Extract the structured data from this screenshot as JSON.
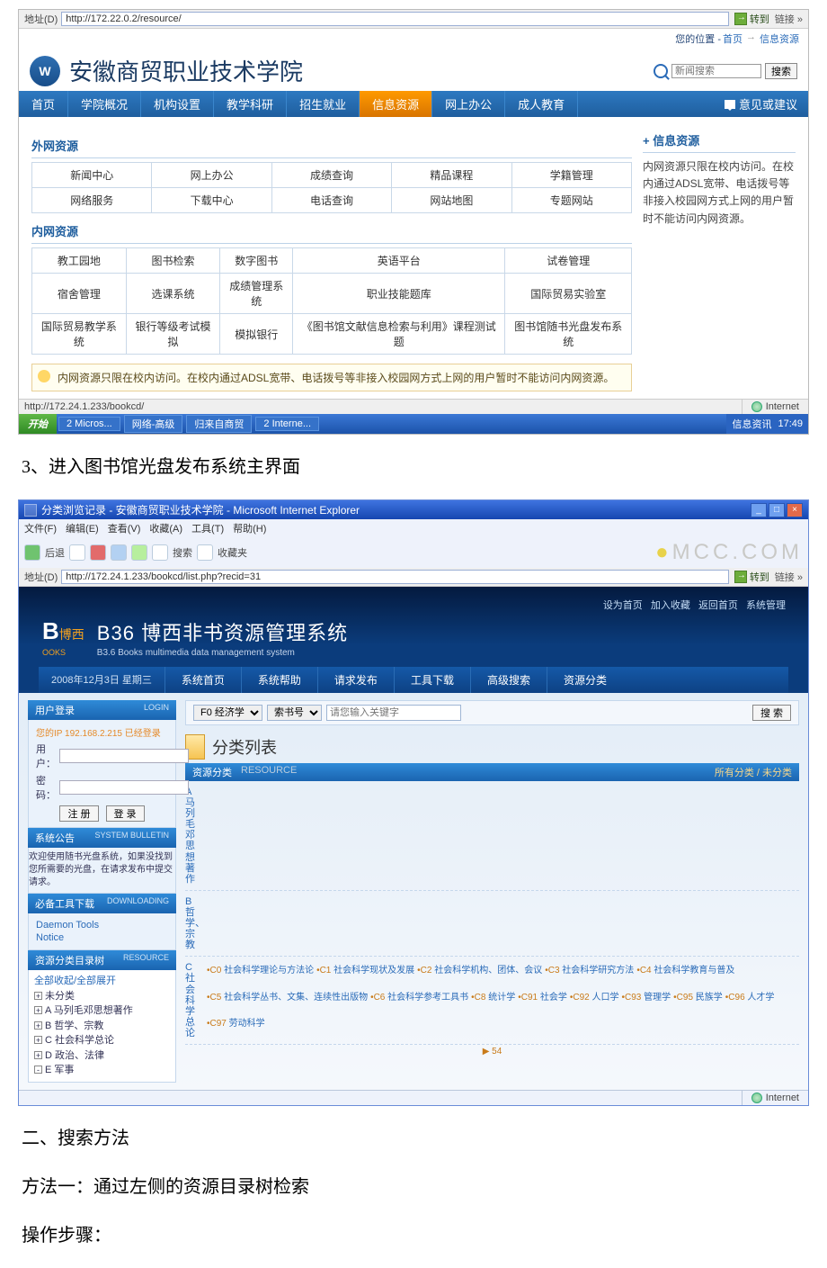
{
  "shot1": {
    "address_label": "地址(D)",
    "url": "http://172.22.0.2/resource/",
    "go_label": "转到",
    "go_tail": "链接 »",
    "breadcrumb_prefix": "您的位置 -",
    "breadcrumb_home": "首页",
    "breadcrumb_sep": "→",
    "breadcrumb_current": "信息资源",
    "school_name": "安徽商贸职业技术学院",
    "search_placeholder": "新闻搜索",
    "search_btn": "搜索",
    "nav": [
      "首页",
      "学院概况",
      "机构设置",
      "教学科研",
      "招生就业",
      "信息资源",
      "网上办公",
      "成人教育"
    ],
    "nav_active_index": 5,
    "feedback": "意见或建议",
    "section_outer": "外网资源",
    "grid_outer": [
      [
        "新闻中心",
        "网上办公",
        "成绩查询",
        "精品课程",
        "学籍管理"
      ],
      [
        "网络服务",
        "下载中心",
        "电话查询",
        "网站地图",
        "专题网站"
      ]
    ],
    "section_inner": "内网资源",
    "grid_inner": [
      [
        "教工园地",
        "图书检索",
        "数字图书",
        "英语平台",
        "试卷管理"
      ],
      [
        "宿舍管理",
        "选课系统",
        "成绩管理系统",
        "职业技能题库",
        "国际贸易实验室"
      ],
      [
        "国际贸易教学系统",
        "银行等级考试模拟",
        "模拟银行",
        "《图书馆文献信息检索与利用》课程测试题",
        "图书馆随书光盘发布系统"
      ]
    ],
    "side_title_prefix": "+",
    "side_title": "信息资源",
    "side_body": "内网资源只限在校内访问。在校内通过ADSL宽带、电话拨号等非接入校园网方式上网的用户暂时不能访问内网资源。",
    "notice": "内网资源只限在校内访问。在校内通过ADSL宽带、电话拨号等非接入校园网方式上网的用户暂时不能访问内网资源。",
    "status_url": "http://172.24.1.233/bookcd/",
    "status_zone": "Internet",
    "taskbar": {
      "start": "开始",
      "buttons": [
        "2 Micros...",
        "网络-高级",
        "归来自商贸",
        "2 Interne..."
      ],
      "tray_msg": "信息资讯",
      "clock": "17:49"
    }
  },
  "doc": {
    "step3": "3、进入图书馆光盘发布系统主界面",
    "h2": "二、搜索方法",
    "m1": "方法一：通过左侧的资源目录树检索",
    "steps_label": "操作步骤："
  },
  "shot2": {
    "window_title": "分类浏览记录 - 安徽商贸职业技术学院 - Microsoft Internet Explorer",
    "menus": [
      "文件(F)",
      "编辑(E)",
      "查看(V)",
      "收藏(A)",
      "工具(T)",
      "帮助(H)"
    ],
    "toolbar": {
      "back": "后退",
      "search": "搜索",
      "fav": "收藏夹"
    },
    "watermark": "MCC.COM",
    "address_label": "地址(D)",
    "url": "http://172.24.1.233/bookcd/list.php?recid=31",
    "go_label": "转到",
    "go_tail": "链接 »",
    "banner_links": {
      "sethome": "设为首页",
      "addfav": "加入收藏",
      "back": "返回首页",
      "admin": "系统管理"
    },
    "brand_tag": "博西",
    "sys_prefix": "B36",
    "sys_title_zh": "博西非书资源管理系统",
    "sys_title_en": "B3.6 Books multimedia data management system",
    "date_line": "2008年12月3日 星期三",
    "nav": [
      "系统首页",
      "系统帮助",
      "请求发布",
      "工具下载",
      "高级搜索",
      "资源分类"
    ],
    "login": {
      "panel": "用户登录",
      "panel_en": "LOGIN",
      "ip_line": "您的IP 192.168.2.215 已经登录",
      "user": "用 户：",
      "pass": "密 码：",
      "reg": "注 册",
      "login": "登 录"
    },
    "bulletin": {
      "title": "系统公告",
      "title_en": "SYSTEM BULLETIN",
      "body": "欢迎使用随书光盘系统，如果没找到您所需要的光盘，在请求发布中提交请求。"
    },
    "tools": {
      "title": "必备工具下载",
      "title_en": "DOWNLOADING",
      "items": [
        "Daemon Tools",
        "Notice"
      ]
    },
    "tree": {
      "title": "资源分类目录树",
      "title_en": "RESOURCE",
      "root": "全部收起/全部展开",
      "nodes": [
        "未分类",
        "A 马列毛邓思想著作",
        "B 哲学、宗教",
        "C 社会科学总论",
        "D 政治、法律",
        "E 军事"
      ]
    },
    "search": {
      "cat_value": "F0 经济学",
      "field_value": "索书号",
      "kw_placeholder": "请您输入关键字",
      "btn": "搜 索"
    },
    "list_title": "分类列表",
    "tabbar": {
      "on": "资源分类",
      "dim": "RESOURCE",
      "right_all": "所有分类",
      "right_un": "未分类"
    },
    "cats": [
      {
        "label": "A 马列毛邓思想著作",
        "subs": []
      },
      {
        "label": "B 哲学、宗教",
        "subs": []
      },
      {
        "label": "C 社会科学总论",
        "subs": [
          {
            "code": "C0",
            "name": "社会科学理论与方法论"
          },
          {
            "code": "C1",
            "name": "社会科学现状及发展"
          },
          {
            "code": "C2",
            "name": "社会科学机构、团体、会议"
          },
          {
            "code": "C3",
            "name": "社会科学研究方法"
          },
          {
            "code": "C4",
            "name": "社会科学教育与普及"
          },
          {
            "code": "C5",
            "name": "社会科学丛书、文集、连续性出版物"
          },
          {
            "code": "C6",
            "name": "社会科学参考工具书"
          },
          {
            "code": "C8",
            "name": "统计学"
          },
          {
            "code": "C91",
            "name": "社会学"
          },
          {
            "code": "C92",
            "name": "人口学"
          },
          {
            "code": "C93",
            "name": "管理学"
          },
          {
            "code": "C95",
            "name": "民族学"
          },
          {
            "code": "C96",
            "name": "人才学"
          },
          {
            "code": "C97",
            "name": "劳动科学"
          }
        ]
      }
    ],
    "more_indicator": "▶ 54",
    "status_zone": "Internet"
  }
}
